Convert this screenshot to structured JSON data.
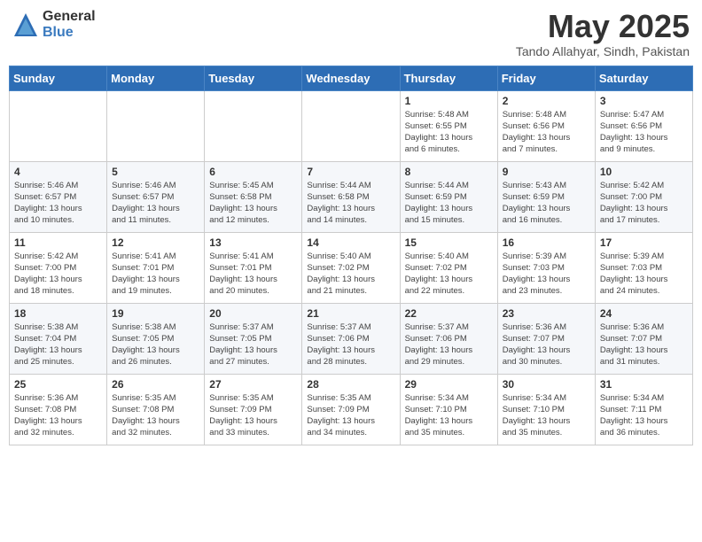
{
  "header": {
    "logo_line1": "General",
    "logo_line2": "Blue",
    "month_year": "May 2025",
    "location": "Tando Allahyar, Sindh, Pakistan"
  },
  "weekdays": [
    "Sunday",
    "Monday",
    "Tuesday",
    "Wednesday",
    "Thursday",
    "Friday",
    "Saturday"
  ],
  "weeks": [
    [
      {
        "day": "",
        "detail": ""
      },
      {
        "day": "",
        "detail": ""
      },
      {
        "day": "",
        "detail": ""
      },
      {
        "day": "",
        "detail": ""
      },
      {
        "day": "1",
        "detail": "Sunrise: 5:48 AM\nSunset: 6:55 PM\nDaylight: 13 hours\nand 6 minutes."
      },
      {
        "day": "2",
        "detail": "Sunrise: 5:48 AM\nSunset: 6:56 PM\nDaylight: 13 hours\nand 7 minutes."
      },
      {
        "day": "3",
        "detail": "Sunrise: 5:47 AM\nSunset: 6:56 PM\nDaylight: 13 hours\nand 9 minutes."
      }
    ],
    [
      {
        "day": "4",
        "detail": "Sunrise: 5:46 AM\nSunset: 6:57 PM\nDaylight: 13 hours\nand 10 minutes."
      },
      {
        "day": "5",
        "detail": "Sunrise: 5:46 AM\nSunset: 6:57 PM\nDaylight: 13 hours\nand 11 minutes."
      },
      {
        "day": "6",
        "detail": "Sunrise: 5:45 AM\nSunset: 6:58 PM\nDaylight: 13 hours\nand 12 minutes."
      },
      {
        "day": "7",
        "detail": "Sunrise: 5:44 AM\nSunset: 6:58 PM\nDaylight: 13 hours\nand 14 minutes."
      },
      {
        "day": "8",
        "detail": "Sunrise: 5:44 AM\nSunset: 6:59 PM\nDaylight: 13 hours\nand 15 minutes."
      },
      {
        "day": "9",
        "detail": "Sunrise: 5:43 AM\nSunset: 6:59 PM\nDaylight: 13 hours\nand 16 minutes."
      },
      {
        "day": "10",
        "detail": "Sunrise: 5:42 AM\nSunset: 7:00 PM\nDaylight: 13 hours\nand 17 minutes."
      }
    ],
    [
      {
        "day": "11",
        "detail": "Sunrise: 5:42 AM\nSunset: 7:00 PM\nDaylight: 13 hours\nand 18 minutes."
      },
      {
        "day": "12",
        "detail": "Sunrise: 5:41 AM\nSunset: 7:01 PM\nDaylight: 13 hours\nand 19 minutes."
      },
      {
        "day": "13",
        "detail": "Sunrise: 5:41 AM\nSunset: 7:01 PM\nDaylight: 13 hours\nand 20 minutes."
      },
      {
        "day": "14",
        "detail": "Sunrise: 5:40 AM\nSunset: 7:02 PM\nDaylight: 13 hours\nand 21 minutes."
      },
      {
        "day": "15",
        "detail": "Sunrise: 5:40 AM\nSunset: 7:02 PM\nDaylight: 13 hours\nand 22 minutes."
      },
      {
        "day": "16",
        "detail": "Sunrise: 5:39 AM\nSunset: 7:03 PM\nDaylight: 13 hours\nand 23 minutes."
      },
      {
        "day": "17",
        "detail": "Sunrise: 5:39 AM\nSunset: 7:03 PM\nDaylight: 13 hours\nand 24 minutes."
      }
    ],
    [
      {
        "day": "18",
        "detail": "Sunrise: 5:38 AM\nSunset: 7:04 PM\nDaylight: 13 hours\nand 25 minutes."
      },
      {
        "day": "19",
        "detail": "Sunrise: 5:38 AM\nSunset: 7:05 PM\nDaylight: 13 hours\nand 26 minutes."
      },
      {
        "day": "20",
        "detail": "Sunrise: 5:37 AM\nSunset: 7:05 PM\nDaylight: 13 hours\nand 27 minutes."
      },
      {
        "day": "21",
        "detail": "Sunrise: 5:37 AM\nSunset: 7:06 PM\nDaylight: 13 hours\nand 28 minutes."
      },
      {
        "day": "22",
        "detail": "Sunrise: 5:37 AM\nSunset: 7:06 PM\nDaylight: 13 hours\nand 29 minutes."
      },
      {
        "day": "23",
        "detail": "Sunrise: 5:36 AM\nSunset: 7:07 PM\nDaylight: 13 hours\nand 30 minutes."
      },
      {
        "day": "24",
        "detail": "Sunrise: 5:36 AM\nSunset: 7:07 PM\nDaylight: 13 hours\nand 31 minutes."
      }
    ],
    [
      {
        "day": "25",
        "detail": "Sunrise: 5:36 AM\nSunset: 7:08 PM\nDaylight: 13 hours\nand 32 minutes."
      },
      {
        "day": "26",
        "detail": "Sunrise: 5:35 AM\nSunset: 7:08 PM\nDaylight: 13 hours\nand 32 minutes."
      },
      {
        "day": "27",
        "detail": "Sunrise: 5:35 AM\nSunset: 7:09 PM\nDaylight: 13 hours\nand 33 minutes."
      },
      {
        "day": "28",
        "detail": "Sunrise: 5:35 AM\nSunset: 7:09 PM\nDaylight: 13 hours\nand 34 minutes."
      },
      {
        "day": "29",
        "detail": "Sunrise: 5:34 AM\nSunset: 7:10 PM\nDaylight: 13 hours\nand 35 minutes."
      },
      {
        "day": "30",
        "detail": "Sunrise: 5:34 AM\nSunset: 7:10 PM\nDaylight: 13 hours\nand 35 minutes."
      },
      {
        "day": "31",
        "detail": "Sunrise: 5:34 AM\nSunset: 7:11 PM\nDaylight: 13 hours\nand 36 minutes."
      }
    ]
  ]
}
